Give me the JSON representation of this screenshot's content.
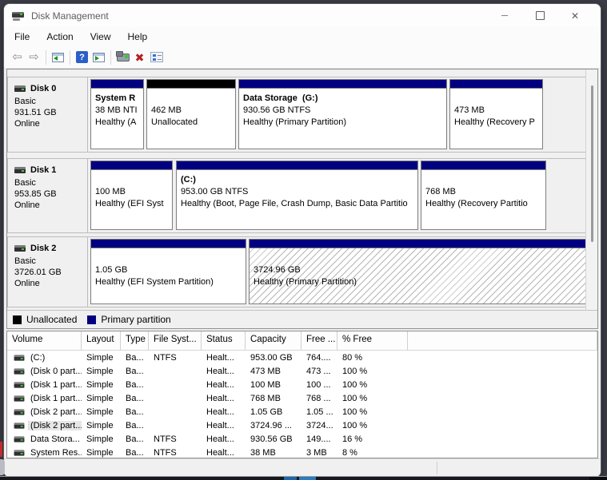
{
  "window": {
    "title": "Disk Management",
    "controls": {
      "minimize": "─",
      "maximize": "maximize",
      "close": "✕"
    }
  },
  "menu": {
    "items": [
      "File",
      "Action",
      "View",
      "Help"
    ]
  },
  "toolbar": {
    "back_glyph": "⇦",
    "forward_glyph": "⇨",
    "help_glyph": "?",
    "delete_glyph": "✖",
    "icon_names": [
      "back-icon",
      "forward-icon",
      "console-tree-icon",
      "help-icon",
      "action-pane-icon",
      "rescan-disks-icon",
      "delete-icon",
      "properties-icon"
    ]
  },
  "disks": [
    {
      "label": {
        "name": "Disk 0",
        "type": "Basic",
        "size": "931.51 GB",
        "status": "Online"
      },
      "partitions": [
        {
          "name": "System R",
          "info": "38 MB NTI",
          "status": "Healthy (A"
        },
        {
          "name": "",
          "info": "462 MB",
          "status": "Unallocated"
        },
        {
          "name": "Data Storage  (G:)",
          "info": "930.56 GB NTFS",
          "status": "Healthy (Primary Partition)"
        },
        {
          "name": "",
          "info": "473 MB",
          "status": "Healthy (Recovery P"
        }
      ]
    },
    {
      "label": {
        "name": "Disk 1",
        "type": "Basic",
        "size": "953.85 GB",
        "status": "Online"
      },
      "partitions": [
        {
          "name": "",
          "info": "100 MB",
          "status": "Healthy (EFI Syst"
        },
        {
          "name": "(C:)",
          "info": "953.00 GB NTFS",
          "status": "Healthy (Boot, Page File, Crash Dump, Basic Data Partitio"
        },
        {
          "name": "",
          "info": "768 MB",
          "status": "Healthy (Recovery Partitio"
        }
      ]
    },
    {
      "label": {
        "name": "Disk 2",
        "type": "Basic",
        "size": "3726.01 GB",
        "status": "Online"
      },
      "partitions": [
        {
          "name": "",
          "info": "1.05 GB",
          "status": "Healthy (EFI System Partition)"
        },
        {
          "name": "",
          "info": "3724.96 GB",
          "status": "Healthy (Primary Partition)"
        }
      ]
    }
  ],
  "legend": [
    {
      "label": "Unallocated",
      "color": "#000000"
    },
    {
      "label": "Primary partition",
      "color": "#000080"
    }
  ],
  "table": {
    "columns": [
      "Volume",
      "Layout",
      "Type",
      "File Syst...",
      "Status",
      "Capacity",
      "Free ...",
      "% Free"
    ],
    "keys": [
      "volume",
      "layout",
      "type",
      "file-system",
      "status",
      "capacity",
      "free-space",
      "pct-free"
    ],
    "rows": [
      {
        "selected": false,
        "cells": [
          "(C:)",
          "Simple",
          "Ba...",
          "NTFS",
          "Healt...",
          "953.00 GB",
          "764....",
          "80 %"
        ]
      },
      {
        "selected": false,
        "cells": [
          "(Disk 0 part...",
          "Simple",
          "Ba...",
          "",
          "Healt...",
          "473 MB",
          "473 ...",
          "100 %"
        ]
      },
      {
        "selected": false,
        "cells": [
          "(Disk 1 part...",
          "Simple",
          "Ba...",
          "",
          "Healt...",
          "100 MB",
          "100 ...",
          "100 %"
        ]
      },
      {
        "selected": false,
        "cells": [
          "(Disk 1 part...",
          "Simple",
          "Ba...",
          "",
          "Healt...",
          "768 MB",
          "768 ...",
          "100 %"
        ]
      },
      {
        "selected": false,
        "cells": [
          "(Disk 2 part...",
          "Simple",
          "Ba...",
          "",
          "Healt...",
          "1.05 GB",
          "1.05 ...",
          "100 %"
        ]
      },
      {
        "selected": true,
        "cells": [
          "(Disk 2 part...",
          "Simple",
          "Ba...",
          "",
          "Healt...",
          "3724.96 ...",
          "3724...",
          "100 %"
        ]
      },
      {
        "selected": false,
        "cells": [
          "Data Stora...",
          "Simple",
          "Ba...",
          "NTFS",
          "Healt...",
          "930.56 GB",
          "149....",
          "16 %"
        ]
      },
      {
        "selected": false,
        "cells": [
          "System Res...",
          "Simple",
          "Ba...",
          "NTFS",
          "Healt...",
          "38 MB",
          "3 MB",
          "8 %"
        ]
      }
    ]
  },
  "colors": {
    "primary_partition": "#000080",
    "unallocated": "#000000",
    "accent_help": "#2a5fc9",
    "delete_red": "#b61f1f"
  }
}
